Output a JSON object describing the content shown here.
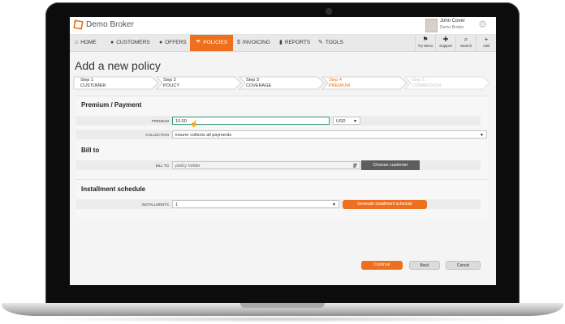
{
  "app": {
    "brand": "Demo Broker"
  },
  "user": {
    "name": "John Cover",
    "company": "Demo Broker"
  },
  "nav": [
    {
      "icon": "home-icon",
      "glyph": "⌂",
      "label": "HOME"
    },
    {
      "icon": "customers-icon",
      "glyph": "👤",
      "label": "CUSTOMERS"
    },
    {
      "icon": "offers-icon",
      "glyph": "➊",
      "label": "OFFERS"
    },
    {
      "icon": "policies-icon",
      "glyph": "☂",
      "label": "POLICIES"
    },
    {
      "icon": "invoicing-icon",
      "glyph": "$",
      "label": "INVOICING"
    },
    {
      "icon": "reports-icon",
      "glyph": "▮",
      "label": "REPORTS"
    },
    {
      "icon": "tools-icon",
      "glyph": "✎",
      "label": "TOOLS"
    }
  ],
  "tools": [
    {
      "icon": "try-demo-icon",
      "glyph": "⚑",
      "label": "Try demo"
    },
    {
      "icon": "support-icon",
      "glyph": "✚",
      "label": "Support"
    },
    {
      "icon": "search-icon",
      "glyph": "⌕",
      "label": "Search"
    },
    {
      "icon": "add-icon",
      "glyph": "+",
      "label": "Add"
    }
  ],
  "page": {
    "title": "Add a new policy"
  },
  "steps": [
    {
      "num": "Step 1",
      "name": "CUSTOMER"
    },
    {
      "num": "Step 2",
      "name": "POLICY"
    },
    {
      "num": "Step 3",
      "name": "COVERAGE"
    },
    {
      "num": "Step 4",
      "name": "PREMIUM"
    },
    {
      "num": "Step 5",
      "name": "COMMISSION"
    }
  ],
  "premium_section": {
    "title": "Premium / Payment",
    "premium_label": "PREMIUM",
    "premium_value": "10.00",
    "currency": "USD",
    "collection_label": "COLLECTION",
    "collection_value": "insurer collects all payments"
  },
  "bill_section": {
    "title": "Bill to",
    "bill_label": "BILL TO",
    "bill_placeholder": "policy holder",
    "choose_button": "Choose customer"
  },
  "installment_section": {
    "title": "Installment schedule",
    "installments_label": "INSTALLMENTS",
    "installments_value": "1",
    "generate_button": "Generate installment schedule"
  },
  "footer": {
    "continue": "Continue",
    "back": "Back",
    "cancel": "Cancel"
  },
  "colors": {
    "accent": "#ee6f1d",
    "focus": "#3a9d7c"
  }
}
